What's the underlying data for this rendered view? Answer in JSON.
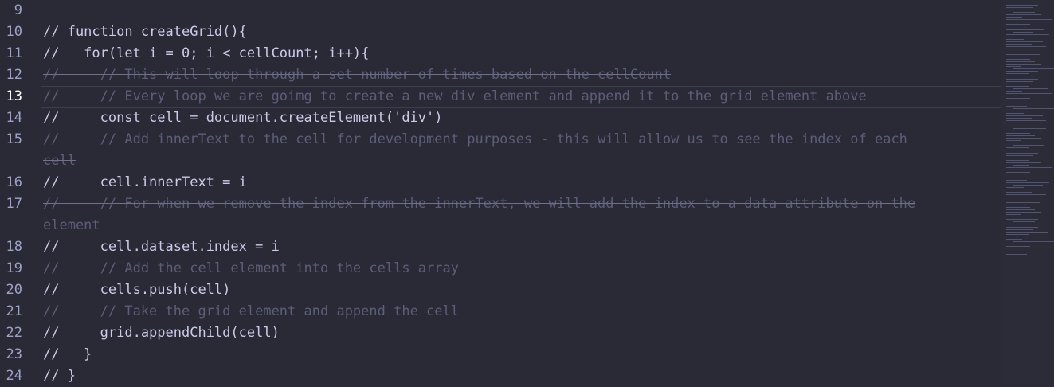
{
  "editor": {
    "lines": [
      {
        "num": "9",
        "text": "",
        "style": "normal"
      },
      {
        "num": "10",
        "text": "// function createGrid(){",
        "style": "normal"
      },
      {
        "num": "11",
        "text": "//   for(let i = 0; i < cellCount; i++){",
        "style": "normal"
      },
      {
        "num": "12",
        "text": "//     // This will loop through a set number of times based on the cellCount",
        "style": "dim"
      },
      {
        "num": "13",
        "text": "//     // Every loop we are goimg to create a new div element and append it to the grid element above",
        "style": "dim",
        "current": true
      },
      {
        "num": "14",
        "text": "//     const cell = document.createElement('div')",
        "style": "normal"
      },
      {
        "num": "15",
        "text": "//     // Add innerText to the cell for development purposes - this will allow us to see the index of each\ncell",
        "style": "dim",
        "wrapped": true
      },
      {
        "num": "16",
        "text": "//     cell.innerText = i",
        "style": "normal"
      },
      {
        "num": "17",
        "text": "//     // For when we remove the index from the innerText, we will add the index to a data attribute on the\nelement",
        "style": "dim",
        "wrapped": true
      },
      {
        "num": "18",
        "text": "//     cell.dataset.index = i",
        "style": "normal"
      },
      {
        "num": "19",
        "text": "//     // Add the cell element into the cells array",
        "style": "dim"
      },
      {
        "num": "20",
        "text": "//     cells.push(cell)",
        "style": "normal"
      },
      {
        "num": "21",
        "text": "//     // Take the grid element and append the cell",
        "style": "dim"
      },
      {
        "num": "22",
        "text": "//     grid.appendChild(cell)",
        "style": "normal"
      },
      {
        "num": "23",
        "text": "//   }",
        "style": "normal"
      },
      {
        "num": "24",
        "text": "// }",
        "style": "normal"
      }
    ],
    "active_line": "13"
  },
  "colors": {
    "background": "#292a36",
    "text": "#c9cbe8",
    "dim_text": "#5b5e78",
    "line_number": "#9ea2c8"
  }
}
